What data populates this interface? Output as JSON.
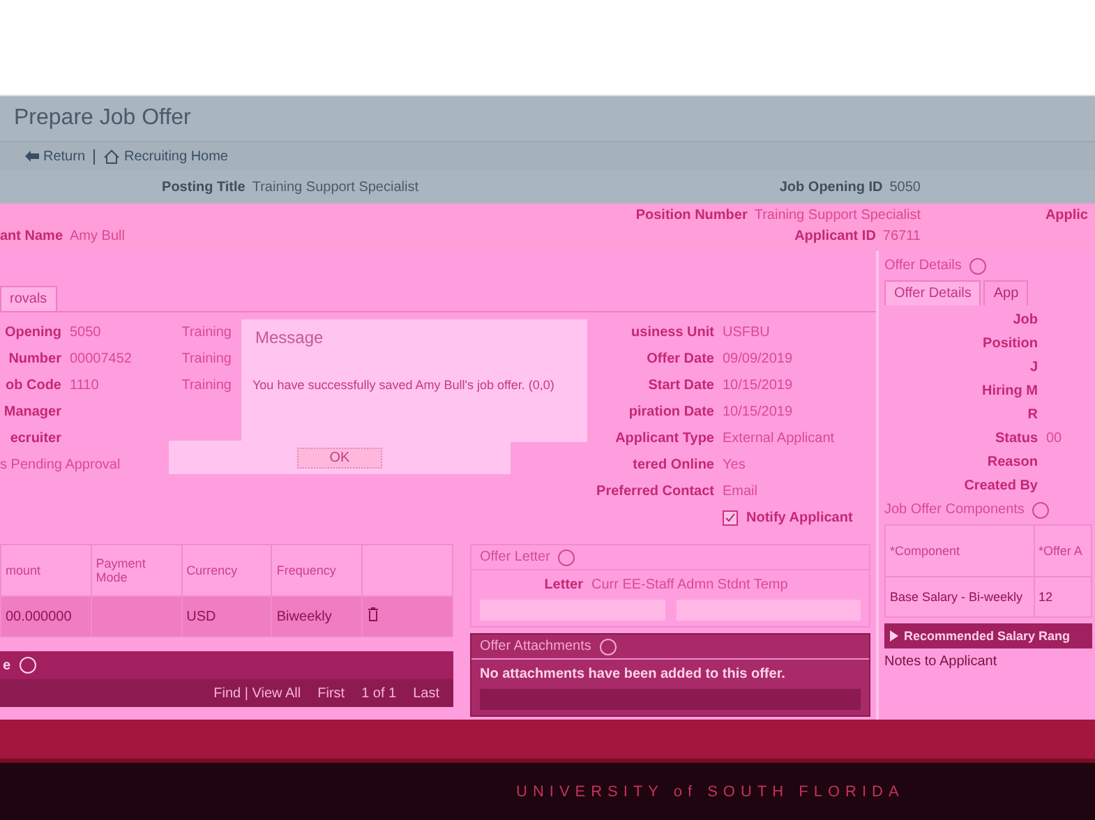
{
  "page": {
    "title": "Prepare Job Offer",
    "nav": [
      {
        "label": "Return"
      },
      {
        "label": "Recruiting Home"
      }
    ]
  },
  "header": {
    "left": [
      {
        "label": "Posting Title",
        "value": "Training Support Specialist"
      },
      {
        "label": "ant Name",
        "value": "Amy Bull"
      }
    ],
    "right": [
      {
        "label": "Job Opening ID",
        "value": "5050"
      },
      {
        "label": "Position Number",
        "value": "Training Support Specialist"
      },
      {
        "label": "Applicant ID",
        "value": "76711"
      }
    ]
  },
  "tabs": [
    {
      "label": "rovals",
      "selected": true
    }
  ],
  "fields_left": [
    {
      "label": "Opening",
      "value": "5050",
      "extra": "Training"
    },
    {
      "label": "Number",
      "value": "00007452",
      "extra": "Training"
    },
    {
      "label": "ob Code",
      "value": "1110",
      "extra": "Training"
    },
    {
      "label": "Manager"
    },
    {
      "label": "ecruiter"
    }
  ],
  "status_text": "s Pending Approval",
  "fields_mid": [
    {
      "label": "usiness Unit",
      "value": "USFBU"
    },
    {
      "label": "Offer Date",
      "value": "09/09/2019"
    },
    {
      "label": "Start Date",
      "value": "10/15/2019"
    },
    {
      "label": "piration Date",
      "value": "10/15/2019"
    },
    {
      "label": "Applicant Type",
      "value": "External Applicant"
    },
    {
      "label": "tered Online",
      "value": "Yes"
    },
    {
      "label": "Preferred Contact",
      "value": "Email"
    }
  ],
  "notify": {
    "label": "Notify Applicant",
    "checked": true
  },
  "comp_table": {
    "columns": [
      "mount",
      "Payment Mode",
      "Currency",
      "Frequency"
    ],
    "rows": [
      [
        "00.000000",
        "",
        "USD",
        "Biweekly"
      ]
    ]
  },
  "comp_bar": {
    "title": "e"
  },
  "pager": {
    "find": "Find | View All",
    "first": "First",
    "count": "1 of 1",
    "last": "Last"
  },
  "offer_letter": {
    "title": "Offer Letter",
    "label": "Letter",
    "value": "Curr EE-Staff Admn Stdnt Temp"
  },
  "attachments": {
    "title": "Offer Attachments",
    "message": "No attachments have been added to this offer."
  },
  "side": {
    "top": "Applic",
    "title": "Offer Details",
    "tabs": [
      {
        "label": "Offer Details",
        "selected": true
      },
      {
        "label": "App",
        "selected": false
      }
    ],
    "fields": [
      {
        "label": "Job"
      },
      {
        "label": "Position"
      },
      {
        "label": "J"
      },
      {
        "label": "Hiring M"
      },
      {
        "label": "R"
      },
      {
        "label": "Status",
        "value": "00"
      },
      {
        "label": "Reason"
      },
      {
        "label": "Created By"
      }
    ],
    "components_title": "Job Offer Components",
    "columns": [
      "*Component",
      "*Offer A"
    ],
    "rows": [
      [
        "Base Salary - Bi-weekly",
        "12"
      ]
    ],
    "salary": "Recommended Salary Rang",
    "notes": "Notes to Applicant"
  },
  "footer": {
    "brand": "UNIVERSITY of SOUTH FLORIDA"
  },
  "dialog": {
    "title": "Message",
    "message": "You have successfully saved Amy Bull's job offer. (0,0)",
    "button": "OK"
  }
}
